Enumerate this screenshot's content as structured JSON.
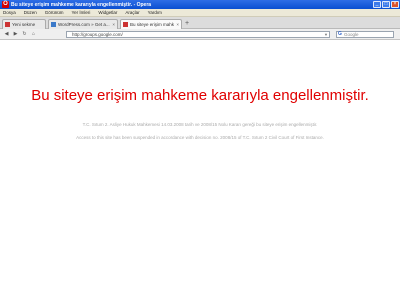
{
  "window": {
    "title": "Bu siteye erişim mahkeme kararıyla engellenmiştir. - Opera",
    "icon_letter": "O",
    "buttons": [
      "_",
      "□",
      "×"
    ]
  },
  "menu": [
    "Dosya",
    "Düzen",
    "Görünüm",
    "Yer İmleri",
    "Widgetlar",
    "Araçlar",
    "Yardım"
  ],
  "tabs": [
    {
      "label": "Yeni sekme",
      "active": false
    },
    {
      "label": "WordPress.com » Get a...",
      "active": false
    },
    {
      "label": "Bu siteye erişim mahkem...",
      "active": true
    }
  ],
  "new_tab_symbol": "+",
  "navigation": {
    "back": "◀",
    "forward": "▶",
    "reload": "↻",
    "home": "⌂",
    "url": "http://groups.google.com/",
    "search_placeholder": "Google",
    "search_logo": "G"
  },
  "content": {
    "heading": "Bu siteye erişim mahkeme kararıyla engellenmiştir.",
    "notice_tr": "T.C. Sıtum 2. Asliye Hukuk Mahkemesi 14.03.2008 tarih ve 2008/15 Nolu Kararı gereği bu siteye erişim engellenmiştir.",
    "notice_en": "Access to this site has been suspended in accordance with decision no. 2008/15 of T.C. Sıtum 2 Civil Court of First Instance."
  },
  "colors": {
    "titlebar": "#0b4fd1",
    "heading": "#e00000",
    "notice": "#aaaaaa"
  }
}
